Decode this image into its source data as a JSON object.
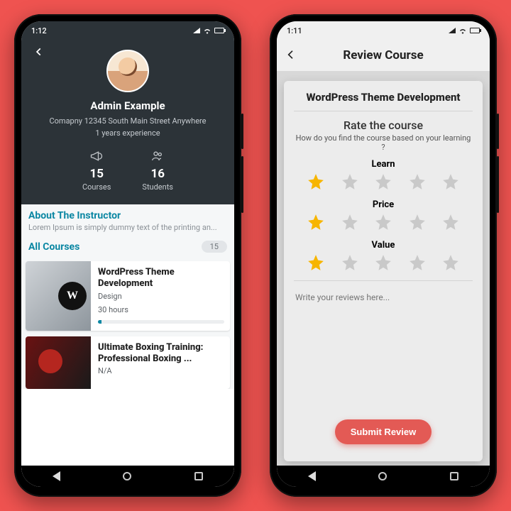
{
  "left": {
    "status_time": "1:12",
    "instructor": {
      "name": "Admin Example",
      "address": "Comapny 12345 South Main Street Anywhere",
      "experience": "1 years experience"
    },
    "stats": {
      "courses": {
        "num": "15",
        "label": "Courses"
      },
      "students": {
        "num": "16",
        "label": "Students"
      }
    },
    "about": {
      "title": "About The Instructor",
      "desc": "Lorem Ipsum is simply dummy text of the printing an..."
    },
    "all_courses": {
      "title": "All Courses",
      "count": "15"
    },
    "courses": [
      {
        "title": "WordPress Theme Development",
        "category": "Design",
        "duration": "30 hours"
      },
      {
        "title": "Ultimate Boxing Training: Professional Boxing ...",
        "category": "N/A",
        "duration": ""
      }
    ]
  },
  "right": {
    "status_time": "1:11",
    "header": "Review Course",
    "course_title": "WordPress Theme Development",
    "rate_heading": "Rate the course",
    "rate_question": "How do you find the course based on your learning ?",
    "criteria": [
      "Learn",
      "Price",
      "Value"
    ],
    "ratings": [
      1,
      1,
      1
    ],
    "placeholder": "Write your reviews here...",
    "submit": "Submit Review"
  },
  "colors": {
    "accent_teal": "#0b87a3",
    "accent_red": "#e35a55",
    "star_on": "#f7b500",
    "star_off": "#c9c9c9"
  }
}
